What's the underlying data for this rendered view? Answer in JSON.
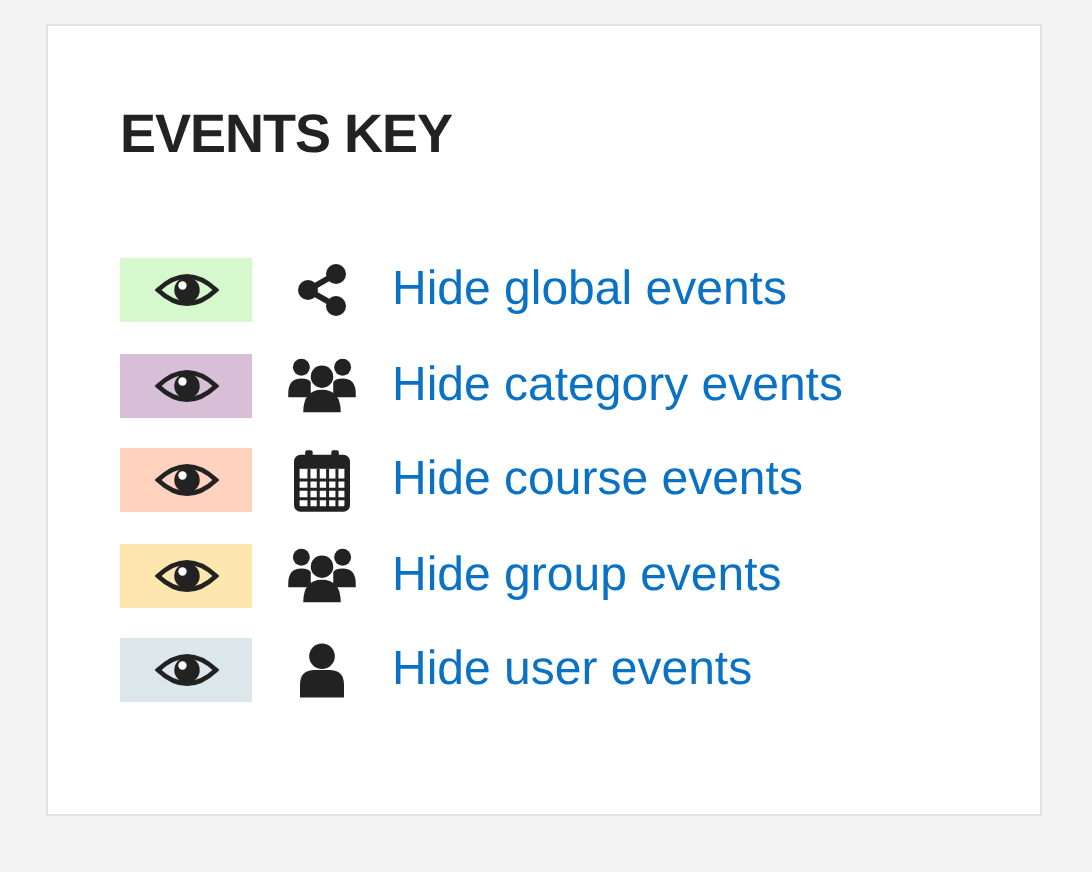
{
  "card": {
    "title": "EVENTS KEY",
    "items": [
      {
        "kind": "share",
        "color": "#d6f8cd",
        "label": "Hide global events"
      },
      {
        "kind": "group",
        "color": "#d8bfd8",
        "label": "Hide category events"
      },
      {
        "kind": "calendar",
        "color": "#ffd3bd",
        "label": "Hide course events"
      },
      {
        "kind": "group",
        "color": "#fee7ae",
        "label": "Hide group events"
      },
      {
        "kind": "user",
        "color": "#dce7ec",
        "label": "Hide user events"
      }
    ]
  }
}
